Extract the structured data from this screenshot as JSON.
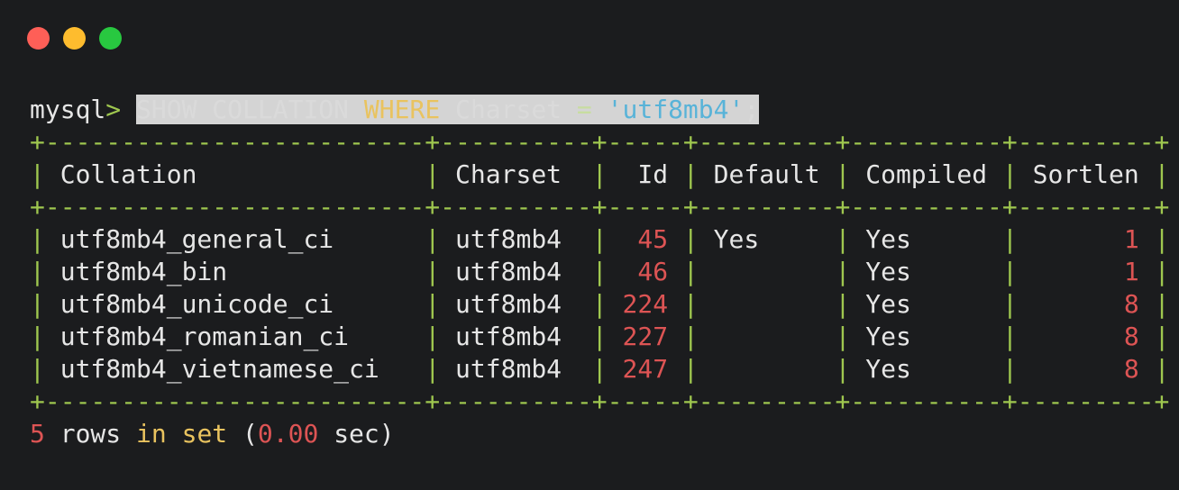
{
  "window": {
    "buttons": [
      "close",
      "minimize",
      "zoom"
    ]
  },
  "command": {
    "prompt": "mysql",
    "prompt_arrow": ">",
    "kw1": "SHOW COLLATION",
    "kw_where": "WHERE",
    "ident": "Charset",
    "op": "=",
    "literal": "'utf8mb4'",
    "terminator": ";"
  },
  "table": {
    "border": "+-------------------------+----------+-----+---------+----------+---------+",
    "header": [
      "Collation",
      "Charset",
      "Id",
      "Default",
      "Compiled",
      "Sortlen"
    ],
    "rows": [
      {
        "collation": "utf8mb4_general_ci",
        "charset": "utf8mb4",
        "id": "45",
        "default": "Yes",
        "compiled": "Yes",
        "sortlen": "1"
      },
      {
        "collation": "utf8mb4_bin",
        "charset": "utf8mb4",
        "id": "46",
        "default": "",
        "compiled": "Yes",
        "sortlen": "1"
      },
      {
        "collation": "utf8mb4_unicode_ci",
        "charset": "utf8mb4",
        "id": "224",
        "default": "",
        "compiled": "Yes",
        "sortlen": "8"
      },
      {
        "collation": "utf8mb4_romanian_ci",
        "charset": "utf8mb4",
        "id": "227",
        "default": "",
        "compiled": "Yes",
        "sortlen": "8"
      },
      {
        "collation": "utf8mb4_vietnamese_ci",
        "charset": "utf8mb4",
        "id": "247",
        "default": "",
        "compiled": "Yes",
        "sortlen": "8"
      }
    ]
  },
  "footer": {
    "count": "5",
    "w_rows": "rows",
    "w_in": "in",
    "w_set": "set",
    "paren_open": "(",
    "time": "0.00",
    "unit": "sec)"
  },
  "colors": {
    "background": "#1b1c1e",
    "border": "#9fc74f",
    "number": "#dd5454",
    "keyword": "#e9c35f",
    "string": "#58b3d8",
    "text": "#e6e6e6"
  }
}
